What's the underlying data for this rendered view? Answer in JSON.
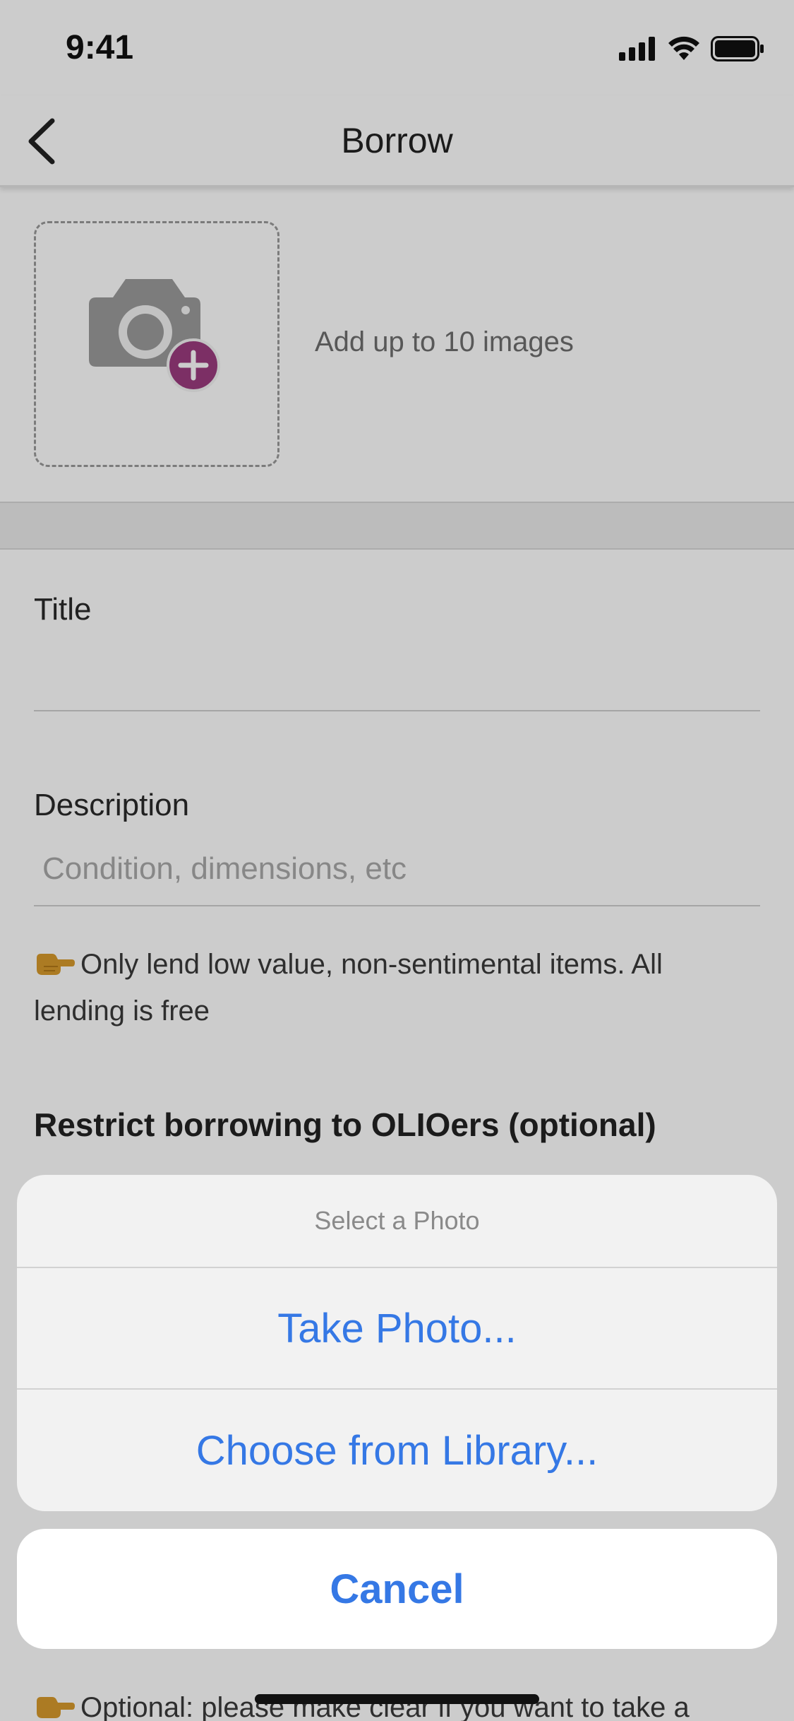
{
  "status_bar": {
    "time": "9:41"
  },
  "nav": {
    "title": "Borrow"
  },
  "photo": {
    "hint": "Add up to 10 images"
  },
  "form": {
    "title_label": "Title",
    "description_label": "Description",
    "description_placeholder": "Condition, dimensions, etc",
    "note": "Only lend low value, non-sentimental items. All lending is free",
    "restrict_label": "Restrict borrowing to OLIOers (optional)",
    "bottom_note": "Optional: please make clear if you want to take a"
  },
  "action_sheet": {
    "title": "Select a Photo",
    "option_take": "Take Photo...",
    "option_library": "Choose from Library...",
    "cancel": "Cancel"
  },
  "colors": {
    "accent_blue": "#3578e5",
    "brand_purple": "#9b3b7f",
    "camera_gray": "#9b9b9b"
  }
}
